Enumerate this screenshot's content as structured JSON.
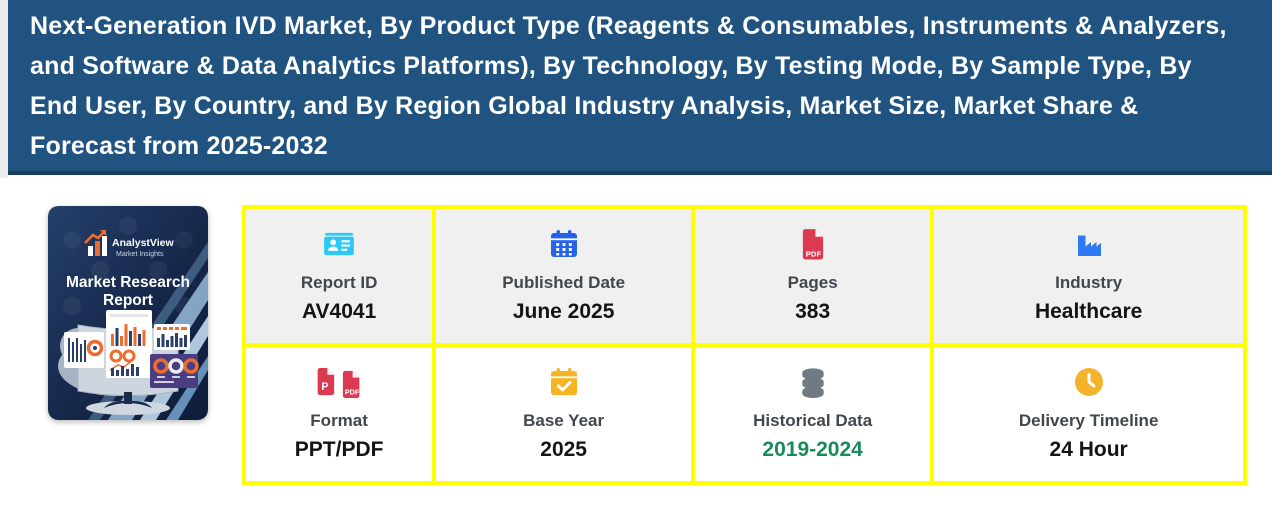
{
  "header": {
    "title": "Next-Generation IVD Market, By Product Type (Reagents & Consumables, Instruments & Analyzers, and Software & Data Analytics Platforms), By Technology, By Testing Mode, By Sample Type, By End User, By Country, and By Region Global Industry Analysis, Market Size, Market Share & Forecast from 2025-2032"
  },
  "thumbnail": {
    "brand": "AnalystView",
    "brand_sub": "Market Insights",
    "cover_title_line1": "Market Research",
    "cover_title_line2": "Report"
  },
  "icons": {
    "pdf_label": "PDF",
    "ppt_label": "P"
  },
  "report_meta": {
    "cells": [
      {
        "label": "Report ID",
        "value": "AV4041",
        "icon": "id-card-icon"
      },
      {
        "label": "Published Date",
        "value": "June 2025",
        "icon": "calendar-icon"
      },
      {
        "label": "Pages",
        "value": "383",
        "icon": "pdf-file-icon"
      },
      {
        "label": "Industry",
        "value": "Healthcare",
        "icon": "factory-icon"
      },
      {
        "label": "Format",
        "value": "PPT/PDF",
        "icon": "ppt-pdf-files-icon"
      },
      {
        "label": "Base Year",
        "value": "2025",
        "icon": "calendar-check-icon"
      },
      {
        "label": "Historical Data",
        "value": "2019-2024",
        "icon": "database-icon"
      },
      {
        "label": "Delivery Timeline",
        "value": "24 Hour",
        "icon": "clock-icon"
      }
    ]
  },
  "colors": {
    "header_bg": "#215381",
    "header_border": "#1b3d60",
    "table_border": "#ffff00",
    "row1_cell_bg": "#f0f0f1",
    "row2_cell_bg": "#ffffff",
    "label_text": "#41474d",
    "value_text": "#141414",
    "historical_value_green": "#1a8a5a",
    "id_card_cyan": "#2bc9f4",
    "calendar_blue": "#2563eb",
    "pdf_red": "#dc3a50",
    "factory_blue": "#2e7af5",
    "base_year_amber": "#f7b322",
    "database_gray": "#717a82",
    "clock_amber": "#f3b32b"
  }
}
